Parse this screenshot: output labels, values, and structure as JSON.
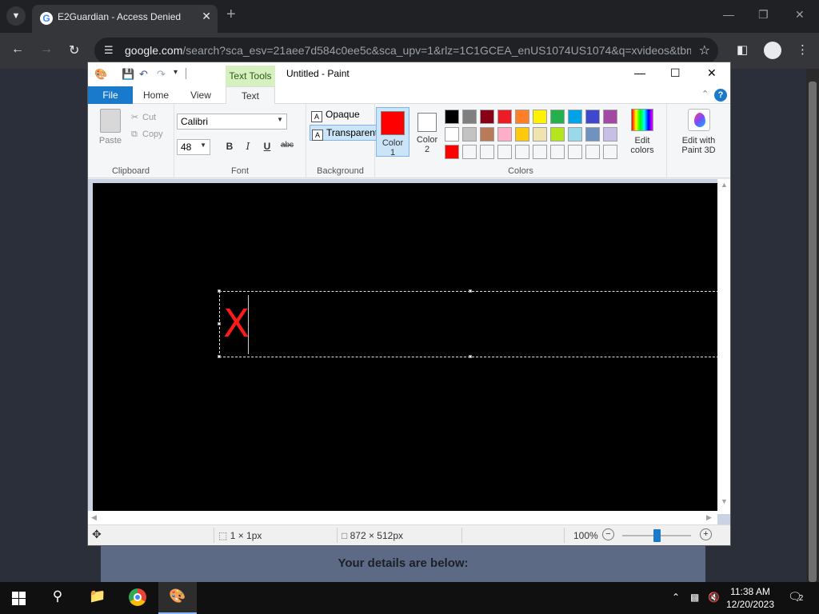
{
  "browser": {
    "tab": {
      "title": "E2Guardian - Access Denied",
      "favicon": "G"
    },
    "address": {
      "host": "google.com",
      "path": "/search?sca_esv=21aee7d584c0ee5c&sca_upv=1&rlz=1C1GCEA_enUS1074US1074&q=xvideos&tbm..."
    }
  },
  "page": {
    "details_heading": "Your details are below:"
  },
  "paint": {
    "title": "Untitled - Paint",
    "contextual_tab": "Text Tools",
    "ribbon_tabs": {
      "file": "File",
      "home": "Home",
      "view": "View",
      "text": "Text"
    },
    "clipboard": {
      "paste": "Paste",
      "cut": "Cut",
      "copy": "Copy",
      "label": "Clipboard"
    },
    "font": {
      "family": "Calibri",
      "size": "48",
      "bold": "B",
      "italic": "I",
      "underline": "U",
      "strikethrough": "abc",
      "label": "Font"
    },
    "background": {
      "opaque": "Opaque",
      "transparent": "Transparent",
      "label": "Background"
    },
    "colors": {
      "color1_label": "Color\n1",
      "color2_label": "Color\n2",
      "color1": "#ff0000",
      "color2": "#ffffff",
      "palette": [
        [
          "#000000",
          "#7f7f7f",
          "#880015",
          "#ed1c24",
          "#ff7f27",
          "#fff200",
          "#22b14c",
          "#00a2e8",
          "#3f48cc",
          "#a349a4"
        ],
        [
          "#ffffff",
          "#c3c3c3",
          "#b97a57",
          "#ffaec9",
          "#ffc90e",
          "#efe4b0",
          "#b5e61d",
          "#99d9ea",
          "#7092be",
          "#c8bfe7"
        ],
        [
          "#ff0000",
          "#f5f6f7",
          "#f5f6f7",
          "#f5f6f7",
          "#f5f6f7",
          "#f5f6f7",
          "#f5f6f7",
          "#f5f6f7",
          "#f5f6f7",
          "#f5f6f7"
        ]
      ],
      "edit_colors": "Edit\ncolors",
      "label": "Colors"
    },
    "paint3d": "Edit with\nPaint 3D",
    "canvas_text": "X",
    "status": {
      "selection": "1 × 1px",
      "size": "872 × 512px",
      "zoom": "100%",
      "zoom_fraction": 0.5
    }
  },
  "taskbar": {
    "time": "11:38 AM",
    "date": "12/20/2023",
    "notifications": "2"
  }
}
